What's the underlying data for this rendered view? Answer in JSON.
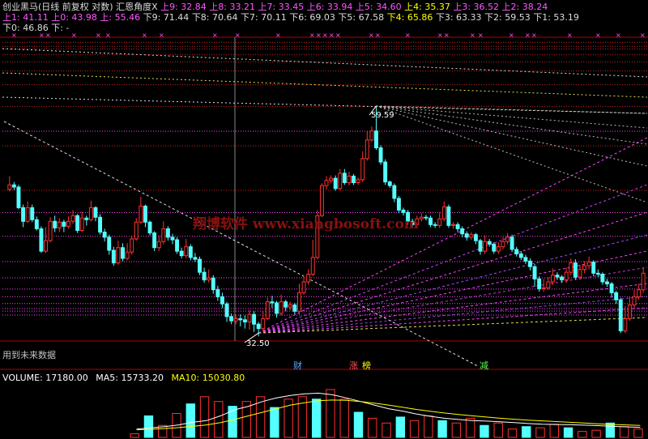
{
  "header": {
    "title": "创业黑马(日线 前复权 对数) 汇恩角度X",
    "up_levels": [
      {
        "label": "上9",
        "value": "32.84"
      },
      {
        "label": "上8",
        "value": "33.21"
      },
      {
        "label": "上7",
        "value": "33.45"
      },
      {
        "label": "上6",
        "value": "33.94"
      },
      {
        "label": "上5",
        "value": "34.60"
      },
      {
        "label": "上4",
        "value": "35.37"
      },
      {
        "label": "上3",
        "value": "36.52"
      },
      {
        "label": "上2",
        "value": "38.24"
      },
      {
        "label": "上1",
        "value": "41.11"
      },
      {
        "label": "上0",
        "value": "43.98"
      },
      {
        "label": "上",
        "value": "55.46"
      }
    ],
    "down_levels": [
      {
        "label": "下9",
        "value": "71.44"
      },
      {
        "label": "下8",
        "value": "70.64"
      },
      {
        "label": "下7",
        "value": "70.11"
      },
      {
        "label": "下6",
        "value": "69.03"
      },
      {
        "label": "下5",
        "value": "67.58"
      },
      {
        "label": "下4",
        "value": "65.86"
      },
      {
        "label": "下3",
        "value": "63.33"
      },
      {
        "label": "下2",
        "value": "59.53"
      },
      {
        "label": "下1",
        "value": "53.19"
      },
      {
        "label": "下0",
        "value": "46.86"
      },
      {
        "label": "下",
        "value": "-"
      }
    ],
    "colors": {
      "up": "#ff55ff",
      "down": "#dcdcdc",
      "highlight": "#ffff00"
    }
  },
  "annotations": {
    "high": "59.59",
    "low": "32.50",
    "future_note": "用到未来数据",
    "watermark": "翔博软件 www.xiangbosoft.com",
    "tag_cai": "财",
    "tag_zhang": "涨",
    "tag_bang": "榜",
    "tag_jian": "减"
  },
  "volume": {
    "label": "VOLUME",
    "value": "17180.00",
    "ma5_label": "MA5",
    "ma5": "15733.20",
    "ma10_label": "MA10",
    "ma10": "15030.80",
    "colors": {
      "up": "#ff3232",
      "down": "#54ffff",
      "ma5": "#ffffff",
      "ma10": "#ffff00"
    }
  },
  "chart_data": {
    "type": "candlestick",
    "log_scale": true,
    "grid": true,
    "price_range": [
      30.5,
      72.5
    ],
    "colors": {
      "up": "#ff3232",
      "down": "#54ffff",
      "grid": "#b00000"
    },
    "candles": [
      [
        47.0,
        47.6,
        48.8,
        46.7
      ],
      [
        47.6,
        47.3,
        48.0,
        46.9
      ],
      [
        47.3,
        44.6,
        47.6,
        44.4
      ],
      [
        44.6,
        42.9,
        45.0,
        42.2
      ],
      [
        42.9,
        44.6,
        45.4,
        42.7
      ],
      [
        44.6,
        43.1,
        45.0,
        42.8
      ],
      [
        43.1,
        42.0,
        43.5,
        41.8
      ],
      [
        42.0,
        39.4,
        42.3,
        39.2
      ],
      [
        39.4,
        40.6,
        42.2,
        39.2
      ],
      [
        40.6,
        42.9,
        43.4,
        40.4
      ],
      [
        42.9,
        42.1,
        43.6,
        41.6
      ],
      [
        42.1,
        42.8,
        43.3,
        41.6
      ],
      [
        42.8,
        42.3,
        43.1,
        41.6
      ],
      [
        42.3,
        42.9,
        43.5,
        42.0
      ],
      [
        42.9,
        43.6,
        44.3,
        42.6
      ],
      [
        43.6,
        41.8,
        43.8,
        41.5
      ],
      [
        41.8,
        43.3,
        44.1,
        41.6
      ],
      [
        43.3,
        43.1,
        43.6,
        42.4
      ],
      [
        43.1,
        44.6,
        45.5,
        42.9
      ],
      [
        44.6,
        43.4,
        44.8,
        42.9
      ],
      [
        43.4,
        41.6,
        43.8,
        41.3
      ],
      [
        41.6,
        41.0,
        42.0,
        40.5
      ],
      [
        41.0,
        39.5,
        41.3,
        39.0
      ],
      [
        39.5,
        38.1,
        39.9,
        37.8
      ],
      [
        38.1,
        39.8,
        40.6,
        37.9
      ],
      [
        39.8,
        38.6,
        40.3,
        38.3
      ],
      [
        38.6,
        39.3,
        40.3,
        38.4
      ],
      [
        39.3,
        40.8,
        41.2,
        39.0
      ],
      [
        40.8,
        42.8,
        43.3,
        40.6
      ],
      [
        42.8,
        44.8,
        46.0,
        42.6
      ],
      [
        44.8,
        42.8,
        45.0,
        42.2
      ],
      [
        42.8,
        41.5,
        43.0,
        41.2
      ],
      [
        41.5,
        39.8,
        41.7,
        39.4
      ],
      [
        39.8,
        40.5,
        41.2,
        39.4
      ],
      [
        40.5,
        42.0,
        42.9,
        40.2
      ],
      [
        42.0,
        41.0,
        42.3,
        40.6
      ],
      [
        41.0,
        40.7,
        41.4,
        40.2
      ],
      [
        40.7,
        39.4,
        41.0,
        39.1
      ],
      [
        39.4,
        38.9,
        39.8,
        38.6
      ],
      [
        38.9,
        39.9,
        40.8,
        38.6
      ],
      [
        39.9,
        38.7,
        40.2,
        38.4
      ],
      [
        38.7,
        38.5,
        39.2,
        38.2
      ],
      [
        38.5,
        37.1,
        38.8,
        36.8
      ],
      [
        37.1,
        36.3,
        37.6,
        36.0
      ],
      [
        36.3,
        36.5,
        37.4,
        36.0
      ],
      [
        36.5,
        35.3,
        36.8,
        34.9
      ],
      [
        35.3,
        34.6,
        35.7,
        34.2
      ],
      [
        34.6,
        33.9,
        35.0,
        33.5
      ],
      [
        33.9,
        32.7,
        34.1,
        32.2
      ],
      [
        32.7,
        32.3,
        33.0,
        32.0
      ],
      [
        32.3,
        32.5,
        32.9,
        32.0
      ],
      [
        32.5,
        32.4,
        32.9,
        31.8
      ],
      [
        32.4,
        32.2,
        32.8,
        31.6
      ],
      [
        32.2,
        32.9,
        33.3,
        31.5
      ],
      [
        32.9,
        32.0,
        33.2,
        31.3
      ],
      [
        32.0,
        31.6,
        32.2,
        30.9
      ],
      [
        31.6,
        32.5,
        33.2,
        31.3
      ],
      [
        32.5,
        34.1,
        34.5,
        32.4
      ],
      [
        34.1,
        34.0,
        34.7,
        33.5
      ],
      [
        34.0,
        33.0,
        34.2,
        32.6
      ],
      [
        33.0,
        34.1,
        34.8,
        32.8
      ],
      [
        34.1,
        33.6,
        34.3,
        33.2
      ],
      [
        33.6,
        33.8,
        34.1,
        33.3
      ],
      [
        33.8,
        33.2,
        34.0,
        32.9
      ],
      [
        33.2,
        35.0,
        35.9,
        32.9
      ],
      [
        35.0,
        36.1,
        36.7,
        34.8
      ],
      [
        36.1,
        36.9,
        37.4,
        35.8
      ],
      [
        36.9,
        38.7,
        40.7,
        36.7
      ],
      [
        38.7,
        43.6,
        44.3,
        38.5
      ],
      [
        43.6,
        47.5,
        47.8,
        43.4
      ],
      [
        47.5,
        48.2,
        48.8,
        47.0
      ],
      [
        48.2,
        48.5,
        48.9,
        47.8
      ],
      [
        48.5,
        47.1,
        48.9,
        46.8
      ],
      [
        47.1,
        49.2,
        49.8,
        46.9
      ],
      [
        49.2,
        47.9,
        49.8,
        47.6
      ],
      [
        47.9,
        48.8,
        49.4,
        47.5
      ],
      [
        48.8,
        47.9,
        49.1,
        47.6
      ],
      [
        47.9,
        48.3,
        48.6,
        47.6
      ],
      [
        48.3,
        51.3,
        52.4,
        48.0
      ],
      [
        51.3,
        54.1,
        55.4,
        51.0
      ],
      [
        54.1,
        55.5,
        56.2,
        53.8
      ],
      [
        55.5,
        52.9,
        59.6,
        52.6
      ],
      [
        52.9,
        50.8,
        53.3,
        50.4
      ],
      [
        50.8,
        48.0,
        51.2,
        47.6
      ],
      [
        48.0,
        47.5,
        48.2,
        47.2
      ],
      [
        47.5,
        45.8,
        47.8,
        45.3
      ],
      [
        45.8,
        44.3,
        46.1,
        43.9
      ],
      [
        44.3,
        44.0,
        44.6,
        43.6
      ],
      [
        44.0,
        42.9,
        44.3,
        42.5
      ],
      [
        42.9,
        42.5,
        43.2,
        42.2
      ],
      [
        42.5,
        43.2,
        43.6,
        42.2
      ],
      [
        43.2,
        43.4,
        43.9,
        42.9
      ],
      [
        43.4,
        43.3,
        43.7,
        43.0
      ],
      [
        43.3,
        42.5,
        43.6,
        42.2
      ],
      [
        42.5,
        42.4,
        42.8,
        42.1
      ],
      [
        42.4,
        43.2,
        44.0,
        42.1
      ],
      [
        43.2,
        44.7,
        45.4,
        42.9
      ],
      [
        44.7,
        42.4,
        45.0,
        42.1
      ],
      [
        42.4,
        42.5,
        42.8,
        42.0
      ],
      [
        42.5,
        42.0,
        42.8,
        41.6
      ],
      [
        42.0,
        41.4,
        42.3,
        41.0
      ],
      [
        41.4,
        41.0,
        41.7,
        40.6
      ],
      [
        41.0,
        41.3,
        41.6,
        40.7
      ],
      [
        41.3,
        40.6,
        41.5,
        40.2
      ],
      [
        40.6,
        39.4,
        40.8,
        39.0
      ],
      [
        39.4,
        40.5,
        41.2,
        39.1
      ],
      [
        40.5,
        40.2,
        40.8,
        39.9
      ],
      [
        40.2,
        39.4,
        40.4,
        39.1
      ],
      [
        39.4,
        39.9,
        40.4,
        39.1
      ],
      [
        39.9,
        40.5,
        41.0,
        39.6
      ],
      [
        40.5,
        41.0,
        41.5,
        40.2
      ],
      [
        41.0,
        39.6,
        41.3,
        39.3
      ],
      [
        39.6,
        39.1,
        39.9,
        38.8
      ],
      [
        39.1,
        38.7,
        39.4,
        38.4
      ],
      [
        38.7,
        38.3,
        39.0,
        38.0
      ],
      [
        38.3,
        37.7,
        38.6,
        37.3
      ],
      [
        37.7,
        36.4,
        38.0,
        35.6
      ],
      [
        36.4,
        35.4,
        36.7,
        35.1
      ],
      [
        35.4,
        35.5,
        36.4,
        35.1
      ],
      [
        35.5,
        36.1,
        36.6,
        35.3
      ],
      [
        36.1,
        36.8,
        37.5,
        35.8
      ],
      [
        36.8,
        36.6,
        37.1,
        36.3
      ],
      [
        36.6,
        36.3,
        36.8,
        36.0
      ],
      [
        36.3,
        37.1,
        37.6,
        36.0
      ],
      [
        37.1,
        38.1,
        38.6,
        36.8
      ],
      [
        38.1,
        36.6,
        38.5,
        36.3
      ],
      [
        36.6,
        37.4,
        37.9,
        36.3
      ],
      [
        37.4,
        37.8,
        38.3,
        37.0
      ],
      [
        37.8,
        38.2,
        38.8,
        37.4
      ],
      [
        38.2,
        37.0,
        38.4,
        36.7
      ],
      [
        37.0,
        36.9,
        37.4,
        36.6
      ],
      [
        36.9,
        36.1,
        37.1,
        35.8
      ],
      [
        36.1,
        35.9,
        36.4,
        35.6
      ],
      [
        35.9,
        35.0,
        36.1,
        34.5
      ],
      [
        35.0,
        34.3,
        35.2,
        33.9
      ],
      [
        34.3,
        31.4,
        34.5,
        31.2
      ],
      [
        31.4,
        32.5,
        33.7,
        31.2
      ],
      [
        32.5,
        33.8,
        34.6,
        32.3
      ],
      [
        33.8,
        34.6,
        35.3,
        33.5
      ],
      [
        34.6,
        35.3,
        35.9,
        34.3
      ],
      [
        35.3,
        37.0,
        37.6,
        35.0
      ]
    ],
    "volumes": [
      1500,
      9000,
      5000,
      10000,
      14000,
      17000,
      15000,
      13000,
      15000,
      17000,
      12500,
      16000,
      17000,
      16000,
      20000,
      16000,
      10500,
      8000,
      6000,
      8500,
      7000,
      9000,
      7000,
      6000,
      8000,
      5000,
      6000,
      3500,
      4500,
      4000,
      5500,
      4000,
      2500,
      3000,
      6000,
      4500,
      3500
    ],
    "ma5": [
      3500,
      4000,
      4500,
      5200,
      6300,
      7000,
      9000,
      11500,
      13000,
      15000,
      16500,
      17500,
      18200,
      18500,
      17800,
      16500,
      15000,
      13500,
      12000,
      11000,
      9800,
      8800,
      8000,
      7500,
      7000,
      6800,
      6500,
      6200,
      5800,
      5500,
      5400,
      5300,
      5100,
      4900,
      4600,
      4400,
      4200
    ],
    "ma10": [
      3200,
      3400,
      3700,
      4100,
      4600,
      5200,
      6200,
      7500,
      9000,
      10500,
      12000,
      13500,
      14500,
      15300,
      15600,
      15500,
      15000,
      14300,
      13500,
      12600,
      11700,
      10900,
      10200,
      9600,
      9000,
      8500,
      8000,
      7600,
      7200,
      6900,
      6600,
      6300,
      6000,
      5700,
      5400,
      5200,
      5000
    ]
  }
}
